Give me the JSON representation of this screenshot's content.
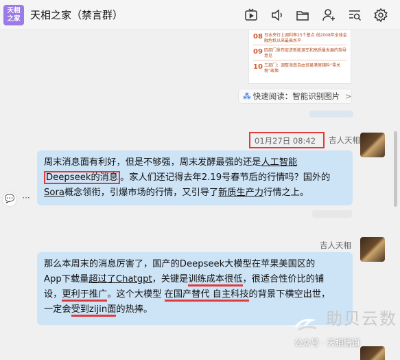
{
  "header": {
    "group_avatar_line1": "天相",
    "group_avatar_line2": "之家",
    "title": "天相之家（禁言群）",
    "icons": [
      "tv-icon",
      "speaker-icon",
      "folder-icon",
      "add-member-icon",
      "search-list-icon",
      "settings-icon"
    ]
  },
  "thumbnail": {
    "items": [
      {
        "num": "08",
        "text": "日本央行上调利率25个基点 创2008年全球金融危机以来最高水平"
      },
      {
        "num": "09",
        "text": "四部门发布促进新能源车和高质量发展的指导意见"
      },
      {
        "num": "10",
        "text": "三部门：调整海南自由贸易港原辅料“零关税”政策"
      }
    ]
  },
  "quickread": {
    "label": "快速阅读：智能识别图片",
    "arrow": ">"
  },
  "messages": [
    {
      "time": "01月27日 08:42",
      "sender": "吉人天相",
      "lines": [
        {
          "a": "周末消息面有利好，但是不够强，周末发酵最强的还是",
          "b": "人工智能"
        },
        {
          "a": "Deepseek的消息",
          "b": "。家人们还记得去年2.19号春节后的行情吗？国外的"
        },
        {
          "a": "Sora",
          "b": "概念领衔，引爆市场的行情，又引导了",
          "c": "新质生产力",
          "d": "行情之上。"
        }
      ]
    },
    {
      "sender": "吉人天相",
      "lines": [
        {
          "a": "那么本周末的消息厉害了，国产的Deepseek大模型在苹果美国区的"
        },
        {
          "a": "App下载量",
          "b": "超过了",
          "c": "Chatgpt",
          "d": "，关键是",
          "e": "训练成本很低",
          "f": "，很适合性价比的铺"
        },
        {
          "a": "设，",
          "b": "更利于推广",
          "c": "。这个大模型 ",
          "d": "在国产替代 自主科技",
          "e": "的背景下横空出世，"
        },
        {
          "a": "一定会",
          "b": "受到zijin面",
          "c": "的热捧。"
        }
      ]
    }
  ],
  "side_buttons": {
    "comment": "💬",
    "more": "···"
  },
  "watermark": {
    "main": "助贝云数",
    "sub": "公众号 · 天相悟道"
  },
  "colors": {
    "bubble": "#cde4f7",
    "highlight_red": "#e23a3a",
    "group_avatar": "#9b7be6"
  }
}
